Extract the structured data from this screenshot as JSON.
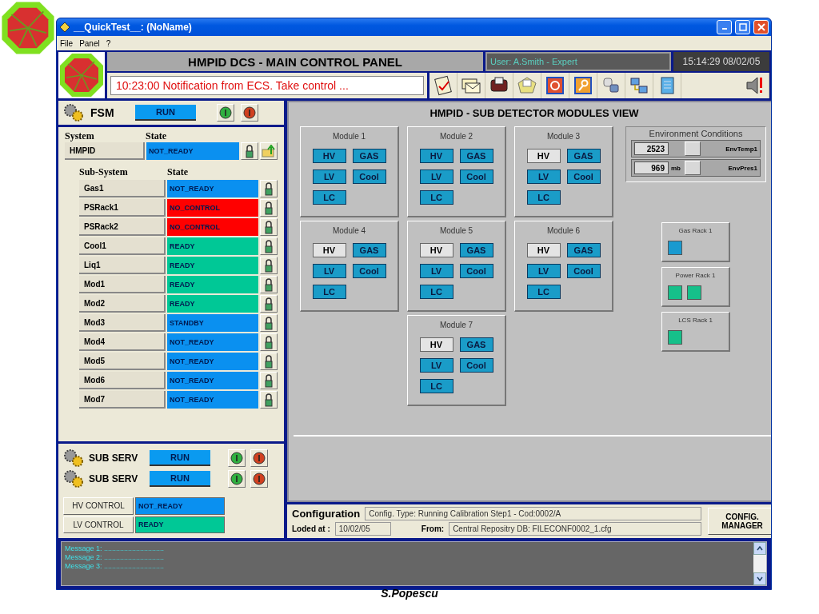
{
  "window": {
    "title": "__QuickTest__: (NoName)"
  },
  "menu": [
    "File",
    "Panel",
    "?"
  ],
  "header": {
    "title": "HMPID  DCS - MAIN CONTROL PANEL",
    "user": "User: A.Smith  - Expert",
    "clock": "15:14:29  08/02/05",
    "notification": "10:23:00 Notification from ECS. Take control ..."
  },
  "fsm": {
    "label": "FSM",
    "state": "RUN"
  },
  "system": {
    "col_system": "System",
    "col_state": "State",
    "name": "HMPID",
    "state": "NOT_READY",
    "color": "#0a90f0",
    "sub_col_system": "Sub-System",
    "sub_col_state": "State",
    "subsystems": [
      {
        "name": "Gas1",
        "state": "NOT_READY",
        "color": "#0a90f0"
      },
      {
        "name": "PSRack1",
        "state": "NO_CONTROL",
        "color": "#ff0000"
      },
      {
        "name": "PSRack2",
        "state": "NO_CONTROL",
        "color": "#ff0000"
      },
      {
        "name": "Cool1",
        "state": "READY",
        "color": "#00c896"
      },
      {
        "name": "Liq1",
        "state": "READY",
        "color": "#00c896"
      },
      {
        "name": "Mod1",
        "state": "READY",
        "color": "#00c896"
      },
      {
        "name": "Mod2",
        "state": "READY",
        "color": "#00c896"
      },
      {
        "name": "Mod3",
        "state": "STANDBY",
        "color": "#0a90f0"
      },
      {
        "name": "Mod4",
        "state": "NOT_READY",
        "color": "#0a90f0"
      },
      {
        "name": "Mod5",
        "state": "NOT_READY",
        "color": "#0a90f0"
      },
      {
        "name": "Mod6",
        "state": "NOT_READY",
        "color": "#0a90f0"
      },
      {
        "name": "Mod7",
        "state": "NOT_READY",
        "color": "#0a90f0"
      }
    ]
  },
  "sub_servs": [
    {
      "label": "SUB SERV",
      "state": "RUN"
    },
    {
      "label": "SUB SERV",
      "state": "RUN"
    }
  ],
  "controls": [
    {
      "label": "HV CONTROL",
      "state": "NOT_READY",
      "color": "#0a90f0"
    },
    {
      "label": "LV CONTROL",
      "state": "READY",
      "color": "#00c896"
    }
  ],
  "modules_view": {
    "title": "HMPID - SUB DETECTOR MODULES VIEW",
    "modules": [
      {
        "name": "Module 1",
        "units": [
          {
            "label": "HV",
            "active": true
          },
          {
            "label": "GAS",
            "active": true
          },
          {
            "label": "LV",
            "active": true
          },
          {
            "label": "Cool",
            "active": true
          },
          {
            "label": "LC",
            "active": true
          }
        ]
      },
      {
        "name": "Module 2",
        "units": [
          {
            "label": "HV",
            "active": true
          },
          {
            "label": "GAS",
            "active": true
          },
          {
            "label": "LV",
            "active": true
          },
          {
            "label": "Cool",
            "active": true
          },
          {
            "label": "LC",
            "active": true
          }
        ]
      },
      {
        "name": "Module 3",
        "units": [
          {
            "label": "HV",
            "active": false
          },
          {
            "label": "GAS",
            "active": true
          },
          {
            "label": "LV",
            "active": true
          },
          {
            "label": "Cool",
            "active": true
          },
          {
            "label": "LC",
            "active": true
          }
        ]
      },
      {
        "name": "Module 4",
        "units": [
          {
            "label": "HV",
            "active": false
          },
          {
            "label": "GAS",
            "active": true
          },
          {
            "label": "LV",
            "active": true
          },
          {
            "label": "Cool",
            "active": true
          },
          {
            "label": "LC",
            "active": true
          }
        ]
      },
      {
        "name": "Module 5",
        "units": [
          {
            "label": "HV",
            "active": false
          },
          {
            "label": "GAS",
            "active": true
          },
          {
            "label": "LV",
            "active": true
          },
          {
            "label": "Cool",
            "active": true
          },
          {
            "label": "LC",
            "active": true
          }
        ]
      },
      {
        "name": "Module 6",
        "units": [
          {
            "label": "HV",
            "active": false
          },
          {
            "label": "GAS",
            "active": true
          },
          {
            "label": "LV",
            "active": true
          },
          {
            "label": "Cool",
            "active": true
          },
          {
            "label": "LC",
            "active": true
          }
        ]
      },
      {
        "name": "Module 7",
        "units": [
          {
            "label": "HV",
            "active": false
          },
          {
            "label": "GAS",
            "active": true
          },
          {
            "label": "LV",
            "active": true
          },
          {
            "label": "Cool",
            "active": true
          },
          {
            "label": "LC",
            "active": true
          }
        ]
      }
    ],
    "environment": {
      "title": "Environment Conditions",
      "readings": [
        {
          "value": "2523",
          "label": "EnvTemp1"
        },
        {
          "value": "969",
          "unit": "mb",
          "label": "EnvPres1"
        }
      ]
    },
    "racks": [
      {
        "name": "Gas Rack 1",
        "indicators": [
          {
            "color": "#1a9ad0"
          }
        ]
      },
      {
        "name": "Power Rack 1",
        "indicators": [
          {
            "color": "#16c08a"
          },
          {
            "color": "#16c08a"
          }
        ]
      },
      {
        "name": "LCS Rack 1",
        "indicators": [
          {
            "color": "#16c08a"
          }
        ]
      }
    ]
  },
  "configuration": {
    "label": "Configuration",
    "type": "Config. Type: Running Calibration Step1 - Cod:0002/A",
    "loaded_label": "Loded at :",
    "loaded": "10/02/05",
    "from_label": "From:",
    "from": "Central Repositry DB: FILECONF0002_1.cfg",
    "button": "CONFIG. MANAGER"
  },
  "messages": [
    "Message 1: ..............................",
    "Message 2: ..............................",
    "Message 3: .............................."
  ],
  "footer": "S.Popescu"
}
